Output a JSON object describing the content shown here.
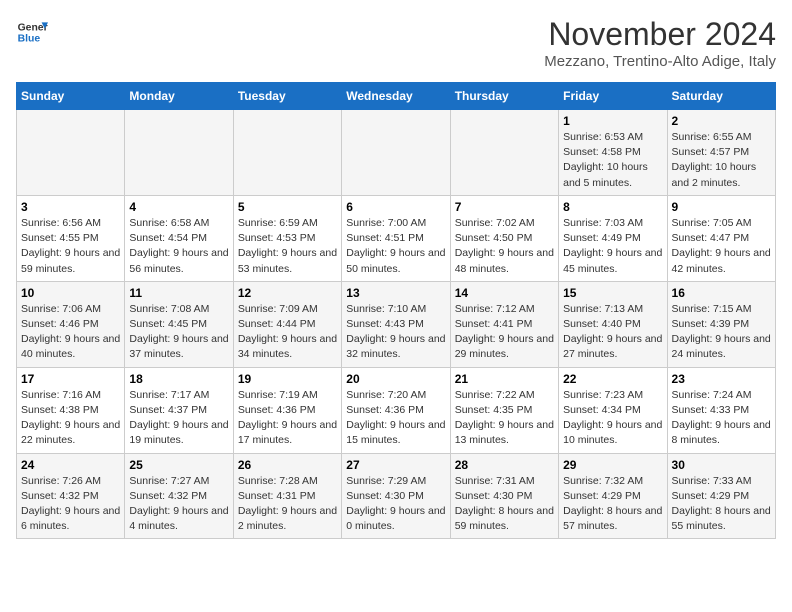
{
  "logo": {
    "text_general": "General",
    "text_blue": "Blue"
  },
  "title": "November 2024",
  "subtitle": "Mezzano, Trentino-Alto Adige, Italy",
  "days_of_week": [
    "Sunday",
    "Monday",
    "Tuesday",
    "Wednesday",
    "Thursday",
    "Friday",
    "Saturday"
  ],
  "weeks": [
    [
      {
        "day": "",
        "info": ""
      },
      {
        "day": "",
        "info": ""
      },
      {
        "day": "",
        "info": ""
      },
      {
        "day": "",
        "info": ""
      },
      {
        "day": "",
        "info": ""
      },
      {
        "day": "1",
        "info": "Sunrise: 6:53 AM\nSunset: 4:58 PM\nDaylight: 10 hours and 5 minutes."
      },
      {
        "day": "2",
        "info": "Sunrise: 6:55 AM\nSunset: 4:57 PM\nDaylight: 10 hours and 2 minutes."
      }
    ],
    [
      {
        "day": "3",
        "info": "Sunrise: 6:56 AM\nSunset: 4:55 PM\nDaylight: 9 hours and 59 minutes."
      },
      {
        "day": "4",
        "info": "Sunrise: 6:58 AM\nSunset: 4:54 PM\nDaylight: 9 hours and 56 minutes."
      },
      {
        "day": "5",
        "info": "Sunrise: 6:59 AM\nSunset: 4:53 PM\nDaylight: 9 hours and 53 minutes."
      },
      {
        "day": "6",
        "info": "Sunrise: 7:00 AM\nSunset: 4:51 PM\nDaylight: 9 hours and 50 minutes."
      },
      {
        "day": "7",
        "info": "Sunrise: 7:02 AM\nSunset: 4:50 PM\nDaylight: 9 hours and 48 minutes."
      },
      {
        "day": "8",
        "info": "Sunrise: 7:03 AM\nSunset: 4:49 PM\nDaylight: 9 hours and 45 minutes."
      },
      {
        "day": "9",
        "info": "Sunrise: 7:05 AM\nSunset: 4:47 PM\nDaylight: 9 hours and 42 minutes."
      }
    ],
    [
      {
        "day": "10",
        "info": "Sunrise: 7:06 AM\nSunset: 4:46 PM\nDaylight: 9 hours and 40 minutes."
      },
      {
        "day": "11",
        "info": "Sunrise: 7:08 AM\nSunset: 4:45 PM\nDaylight: 9 hours and 37 minutes."
      },
      {
        "day": "12",
        "info": "Sunrise: 7:09 AM\nSunset: 4:44 PM\nDaylight: 9 hours and 34 minutes."
      },
      {
        "day": "13",
        "info": "Sunrise: 7:10 AM\nSunset: 4:43 PM\nDaylight: 9 hours and 32 minutes."
      },
      {
        "day": "14",
        "info": "Sunrise: 7:12 AM\nSunset: 4:41 PM\nDaylight: 9 hours and 29 minutes."
      },
      {
        "day": "15",
        "info": "Sunrise: 7:13 AM\nSunset: 4:40 PM\nDaylight: 9 hours and 27 minutes."
      },
      {
        "day": "16",
        "info": "Sunrise: 7:15 AM\nSunset: 4:39 PM\nDaylight: 9 hours and 24 minutes."
      }
    ],
    [
      {
        "day": "17",
        "info": "Sunrise: 7:16 AM\nSunset: 4:38 PM\nDaylight: 9 hours and 22 minutes."
      },
      {
        "day": "18",
        "info": "Sunrise: 7:17 AM\nSunset: 4:37 PM\nDaylight: 9 hours and 19 minutes."
      },
      {
        "day": "19",
        "info": "Sunrise: 7:19 AM\nSunset: 4:36 PM\nDaylight: 9 hours and 17 minutes."
      },
      {
        "day": "20",
        "info": "Sunrise: 7:20 AM\nSunset: 4:36 PM\nDaylight: 9 hours and 15 minutes."
      },
      {
        "day": "21",
        "info": "Sunrise: 7:22 AM\nSunset: 4:35 PM\nDaylight: 9 hours and 13 minutes."
      },
      {
        "day": "22",
        "info": "Sunrise: 7:23 AM\nSunset: 4:34 PM\nDaylight: 9 hours and 10 minutes."
      },
      {
        "day": "23",
        "info": "Sunrise: 7:24 AM\nSunset: 4:33 PM\nDaylight: 9 hours and 8 minutes."
      }
    ],
    [
      {
        "day": "24",
        "info": "Sunrise: 7:26 AM\nSunset: 4:32 PM\nDaylight: 9 hours and 6 minutes."
      },
      {
        "day": "25",
        "info": "Sunrise: 7:27 AM\nSunset: 4:32 PM\nDaylight: 9 hours and 4 minutes."
      },
      {
        "day": "26",
        "info": "Sunrise: 7:28 AM\nSunset: 4:31 PM\nDaylight: 9 hours and 2 minutes."
      },
      {
        "day": "27",
        "info": "Sunrise: 7:29 AM\nSunset: 4:30 PM\nDaylight: 9 hours and 0 minutes."
      },
      {
        "day": "28",
        "info": "Sunrise: 7:31 AM\nSunset: 4:30 PM\nDaylight: 8 hours and 59 minutes."
      },
      {
        "day": "29",
        "info": "Sunrise: 7:32 AM\nSunset: 4:29 PM\nDaylight: 8 hours and 57 minutes."
      },
      {
        "day": "30",
        "info": "Sunrise: 7:33 AM\nSunset: 4:29 PM\nDaylight: 8 hours and 55 minutes."
      }
    ]
  ]
}
